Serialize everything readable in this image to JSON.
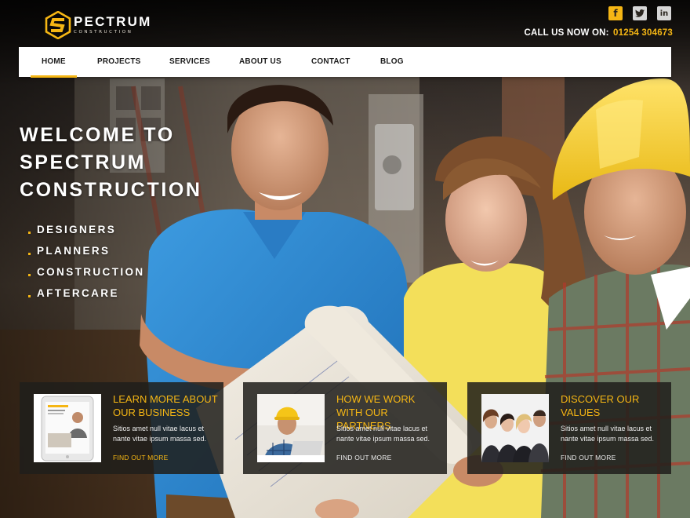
{
  "brand": {
    "name": "PECTRUM",
    "tagline": "CONSTRUCTION",
    "accent_color": "#f5b614",
    "logo_icon": "hexagon-s-logo-icon"
  },
  "social": [
    {
      "name": "facebook",
      "icon": "facebook-icon",
      "glyph": "f"
    },
    {
      "name": "twitter",
      "icon": "twitter-icon",
      "glyph": "t"
    },
    {
      "name": "linkedin",
      "icon": "linkedin-icon",
      "glyph": "in"
    }
  ],
  "contact": {
    "label": "CALL US NOW ON:",
    "phone": "01254 304673"
  },
  "nav": {
    "items": [
      {
        "label": "HOME",
        "active": true
      },
      {
        "label": "PROJECTS",
        "active": false
      },
      {
        "label": "SERVICES",
        "active": false
      },
      {
        "label": "ABOUT US",
        "active": false
      },
      {
        "label": "CONTACT",
        "active": false
      },
      {
        "label": "BLOG",
        "active": false
      }
    ]
  },
  "hero": {
    "title_lines": [
      "WELCOME TO",
      "SPECTRUM",
      "CONSTRUCTION"
    ],
    "list": [
      "DESIGNERS",
      "PLANNERS",
      "CONSTRUCTION",
      "AFTERCARE"
    ]
  },
  "cards": [
    {
      "title": "LEARN MORE ABOUT OUR BUSINESS",
      "text": "Sitios amet null vitae lacus et nante vitae ipsum massa sed.",
      "link": "FIND OUT MORE",
      "thumb_icon": "tablet-icon"
    },
    {
      "title": "HOW WE WORK WITH OUR PARTNERS",
      "text": "Sitios amet null vitae lacus et nante vitae ipsum massa sed.",
      "link": "FIND OUT MORE",
      "thumb_icon": "worker-laptop-photo"
    },
    {
      "title": "DISCOVER OUR VALUES",
      "text": "Sitios amet null vitae lacus et nante vitae ipsum massa sed.",
      "link": "FIND OUT MORE",
      "thumb_icon": "team-photo"
    }
  ]
}
